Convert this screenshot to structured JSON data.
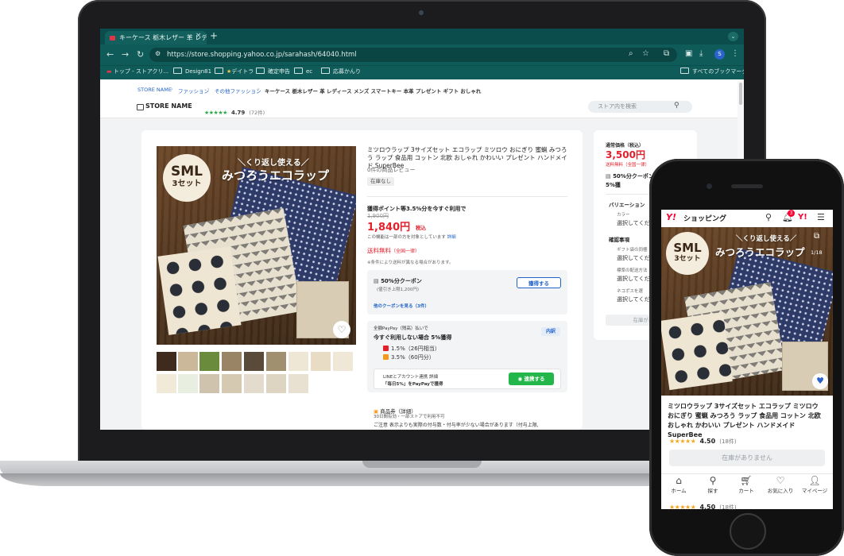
{
  "browser": {
    "tab_title": "キーケース 栃木レザー 革 レディ",
    "tab_close": "×",
    "new_tab": "+",
    "url": "https://store.shopping.yahoo.co.jp/sarahash/64040.html",
    "profile_initial": "S",
    "bookmarks": [
      {
        "label": "トップ - ストアクリ..."
      },
      {
        "label": "Design81"
      },
      {
        "label": "デイトラ"
      },
      {
        "label": "確定申告"
      },
      {
        "label": "ec"
      },
      {
        "label": "応募かんり"
      }
    ],
    "all_bookmarks": "すべてのブックマーク"
  },
  "store": {
    "breadcrumbs": [
      "STORE NAME",
      "ファッション",
      "その他ファッション"
    ],
    "breadcrumb_current": "キーケース 栃木レザー 革 レディース メンズ スマートキー 本革 プレゼント ギフト おしゃれ",
    "name": "STORE NAME",
    "stars": "★★★★★",
    "rating": "4.79",
    "review_count": "(72件)",
    "search_placeholder": "ストア内を検索"
  },
  "product": {
    "image_title_line1": "＼くり返し使える／",
    "image_title_line2": "みつろうエコラップ",
    "badge_line1": "SML",
    "badge_line2": "3セット",
    "title": "ミツロウラップ 3サイズセット エコラップ ミツロウ おにぎり 蜜蝋 みつろう ラップ 食品用 コットン 北欧 おしゃれ かわいい プレゼント ハンドメイド SuperBee",
    "reviews": "0件の商品レビュー",
    "stock_tag": "在庫なし",
    "point_text": "獲得ポイント等3.5%分を今すぐ利用で",
    "old_price": "1,900円",
    "price": "1,840円",
    "tax": "税込",
    "price_note": "この機能は一部の方を対象としています",
    "price_note_link": "詳細",
    "shipping": "送料無料",
    "shipping_sub": "（全国一律）",
    "shipping_cond": "※条件により送料が異なる場合があります。"
  },
  "coupon": {
    "title": "50%分クーポン",
    "sub": "(値引き上限1,200円)",
    "button": "獲得する",
    "more": "他のクーポンを見る（3件）"
  },
  "paypay": {
    "head": "全額PayPay（残高）払いで",
    "main": "今すぐ利用しない場合  5%獲得",
    "naiyaku": "内訳",
    "line1": "1.5%（26円相当）",
    "line2": "3.5%（60円分）",
    "line_t1": "LINEとアカウント連携  詳細",
    "line_t2": "「毎日5%」をPayPayで獲得",
    "line_btn": "連携する"
  },
  "gift": {
    "title": "商品券（詳細）",
    "sub": "30日間有効・一部ストアで利用不可",
    "caution": "ご注意 表示よりも実際の付与数・付与率が少ない場合があります（付与上限,"
  },
  "side": {
    "label": "通常価格（税込）",
    "price": "3,500円",
    "ship": "送料無料（全国一律）",
    "coupon": "50%分クーポン",
    "coupon2": "5%獲",
    "variation_h": "バリエーション",
    "color_label": "カラー",
    "select_text": "選択してくだ",
    "confirm_h": "確認事項",
    "gift_label": "ギフト袋の同梱",
    "std_label": "標準の配送方法",
    "neko_label": "ネコポスを選",
    "stock_btn": "在庫がありま"
  },
  "phone": {
    "logo": "Y!",
    "logo_text": "ショッピング",
    "cart_badge": "3",
    "slide": "1/18",
    "title": "ミツロウラップ 3サイズセット エコラップ ミツロウ おにぎり 蜜蝋 みつろう ラップ 食品用 コットン 北欧 おしゃれ かわいい プレゼント ハンドメイド SuperBee",
    "stars": "★★★★★",
    "rating": "4.50",
    "count": "(18件)",
    "stock": "在庫がありません",
    "tabs": [
      {
        "label": "ホーム"
      },
      {
        "label": "探す"
      },
      {
        "label": "カート"
      },
      {
        "label": "お気に入り"
      },
      {
        "label": "マイページ"
      }
    ]
  },
  "colors": {
    "chrome": "#0f5b59",
    "price_red": "#e3212d",
    "link_blue": "#1f62c8",
    "line_green": "#22b64b",
    "yahoo_red": "#ff0033"
  }
}
